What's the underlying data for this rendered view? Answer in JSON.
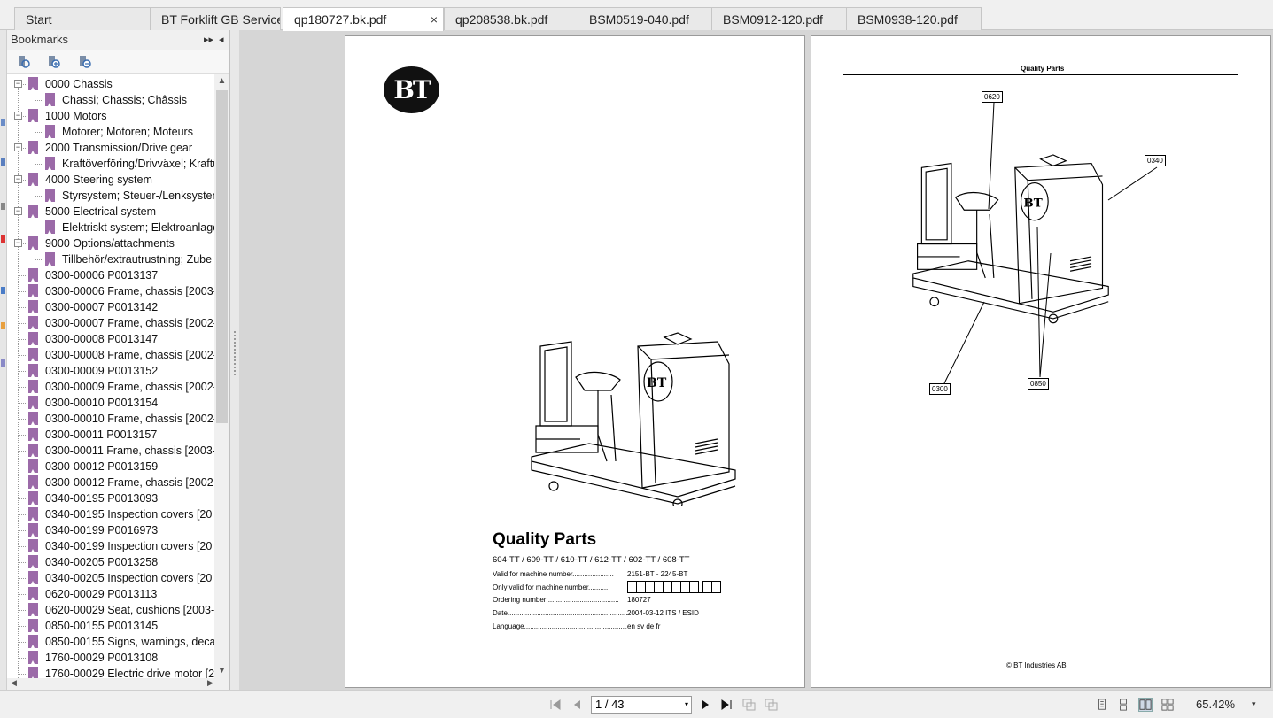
{
  "tabs": [
    {
      "label": "Start"
    },
    {
      "label": "BT Forklift GB Service ..."
    },
    {
      "label": "qp180727.bk.pdf",
      "close": "×"
    },
    {
      "label": "qp208538.bk.pdf"
    },
    {
      "label": "BSM0519-040.pdf"
    },
    {
      "label": "BSM0912-120.pdf"
    },
    {
      "label": "BSM0938-120.pdf"
    }
  ],
  "bookmarks_panel": {
    "title": "Bookmarks",
    "expand_glyph": "▸▸",
    "collapse_glyph": "◂",
    "tree": [
      {
        "label": "0000 Chassis",
        "level": 0,
        "expander": "−"
      },
      {
        "label": "Chassi; Chassis; Châssis",
        "level": 1
      },
      {
        "label": "1000 Motors",
        "level": 0,
        "expander": "−"
      },
      {
        "label": "Motorer; Motoren; Moteurs",
        "level": 1
      },
      {
        "label": "2000 Transmission/Drive gear",
        "level": 0,
        "expander": "−"
      },
      {
        "label": "Kraftöverföring/Drivväxel; Kraftü",
        "level": 1
      },
      {
        "label": "4000 Steering system",
        "level": 0,
        "expander": "−"
      },
      {
        "label": "Styrsystem; Steuer-/Lenksysten",
        "level": 1
      },
      {
        "label": "5000 Electrical system",
        "level": 0,
        "expander": "−"
      },
      {
        "label": "Elektriskt system; Elektroanlage",
        "level": 1
      },
      {
        "label": "9000 Options/attachments",
        "level": 0,
        "expander": "−"
      },
      {
        "label": "Tillbehör/extrautrustning; Zube",
        "level": 1
      },
      {
        "label": "0300-00006 P0013137",
        "level": 0
      },
      {
        "label": "0300-00006 Frame, chassis [2003-0",
        "level": 0
      },
      {
        "label": "0300-00007 P0013142",
        "level": 0
      },
      {
        "label": "0300-00007 Frame, chassis [2002-0",
        "level": 0
      },
      {
        "label": "0300-00008 P0013147",
        "level": 0
      },
      {
        "label": "0300-00008 Frame, chassis [2002-0",
        "level": 0
      },
      {
        "label": "0300-00009 P0013152",
        "level": 0
      },
      {
        "label": "0300-00009 Frame, chassis [2002-0",
        "level": 0
      },
      {
        "label": "0300-00010 P0013154",
        "level": 0
      },
      {
        "label": "0300-00010 Frame, chassis [2002-0",
        "level": 0
      },
      {
        "label": "0300-00011 P0013157",
        "level": 0
      },
      {
        "label": "0300-00011 Frame, chassis [2003-0",
        "level": 0
      },
      {
        "label": "0300-00012 P0013159",
        "level": 0
      },
      {
        "label": "0300-00012 Frame, chassis [2002-0",
        "level": 0
      },
      {
        "label": "0340-00195 P0013093",
        "level": 0
      },
      {
        "label": "0340-00195 Inspection covers [20",
        "level": 0
      },
      {
        "label": "0340-00199 P0016973",
        "level": 0
      },
      {
        "label": "0340-00199 Inspection covers [20",
        "level": 0
      },
      {
        "label": "0340-00205 P0013258",
        "level": 0
      },
      {
        "label": "0340-00205 Inspection covers [20",
        "level": 0
      },
      {
        "label": "0620-00029 P0013113",
        "level": 0
      },
      {
        "label": "0620-00029 Seat, cushions [2003-",
        "level": 0
      },
      {
        "label": "0850-00155 P0013145",
        "level": 0
      },
      {
        "label": "0850-00155 Signs, warnings, decal",
        "level": 0
      },
      {
        "label": "1760-00029 P0013108",
        "level": 0
      },
      {
        "label": "1760-00029 Electric drive motor [2",
        "level": 0
      }
    ]
  },
  "left_page": {
    "logo_text": "BT",
    "title": "Quality Parts",
    "models": "604-TT / 609-TT / 610-TT / 612-TT / 602-TT / 608-TT",
    "rows": [
      {
        "key": "Valid for machine number.....................",
        "value": "2151-BT - 2245-BT"
      },
      {
        "key": "Only valid for machine number...........",
        "value": ""
      },
      {
        "key": "Ordering number ....................................",
        "value": "180727"
      },
      {
        "key": "Date...............................................................",
        "value": "2004-03-12 ITS / ESID"
      },
      {
        "key": "Language........................................................",
        "value": " en sv de fr"
      }
    ]
  },
  "right_page": {
    "title": "Quality Parts",
    "footer": "© BT Industries AB",
    "callouts": [
      "0620",
      "0340",
      "0300",
      "0850"
    ]
  },
  "statusbar": {
    "page_indicator": "1 / 43",
    "zoom": "65.42%",
    "dropdown_glyph": "▾"
  },
  "colors": {
    "bookmark_icon": "#9b6aa8",
    "tab_active": "#ffffff",
    "doc_background": "#d6d6d6"
  }
}
